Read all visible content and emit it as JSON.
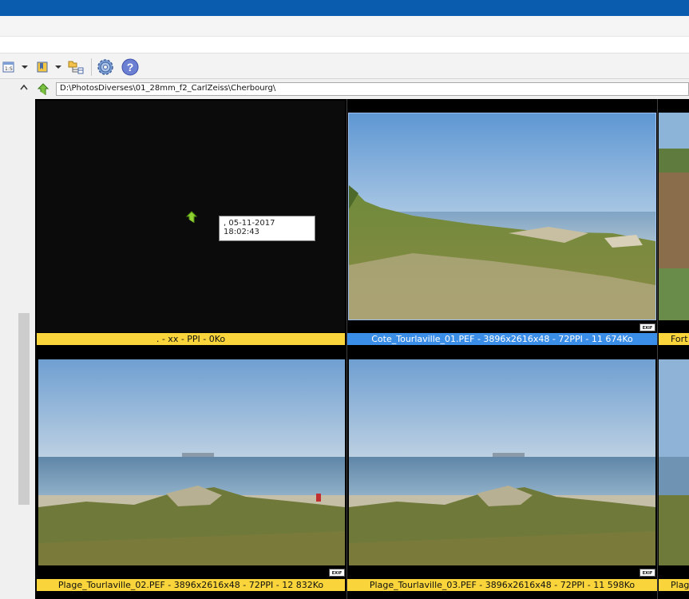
{
  "address_bar": {
    "path": "D:\\PhotosDiverses\\01_28mm_f2_CarlZeiss\\Cherbourg\\"
  },
  "toolbar": {
    "icons": [
      "slideshow-icon",
      "bookmark-icon",
      "folder-tree-icon",
      "settings-gear-icon",
      "help-icon"
    ],
    "help_glyph": "?"
  },
  "thumbnails": [
    {
      "caption": ". - xx - PPI - 0Ko",
      "tooltip": ", 05-11-2017 18:02:43",
      "type": "parent-folder"
    },
    {
      "caption": "Cote_Tourlaville_01.PEF - 3896x2616x48 - 72PPI - 11 674Ko",
      "exif": "EXIF",
      "selected": true
    },
    {
      "caption": "Fort",
      "partial": true
    },
    {
      "caption": "Plage_Tourlaville_02.PEF - 3896x2616x48 - 72PPI - 12 832Ko",
      "exif": "EXIF"
    },
    {
      "caption": "Plage_Tourlaville_03.PEF - 3896x2616x48 - 72PPI - 11 598Ko",
      "exif": "EXIF"
    },
    {
      "caption": "Plag",
      "partial": true
    }
  ],
  "colors": {
    "title_bar": "#0a5cae",
    "caption_yellow": "#f9d43a",
    "caption_selected": "#3b8ee8",
    "grid_bg": "#000000"
  }
}
